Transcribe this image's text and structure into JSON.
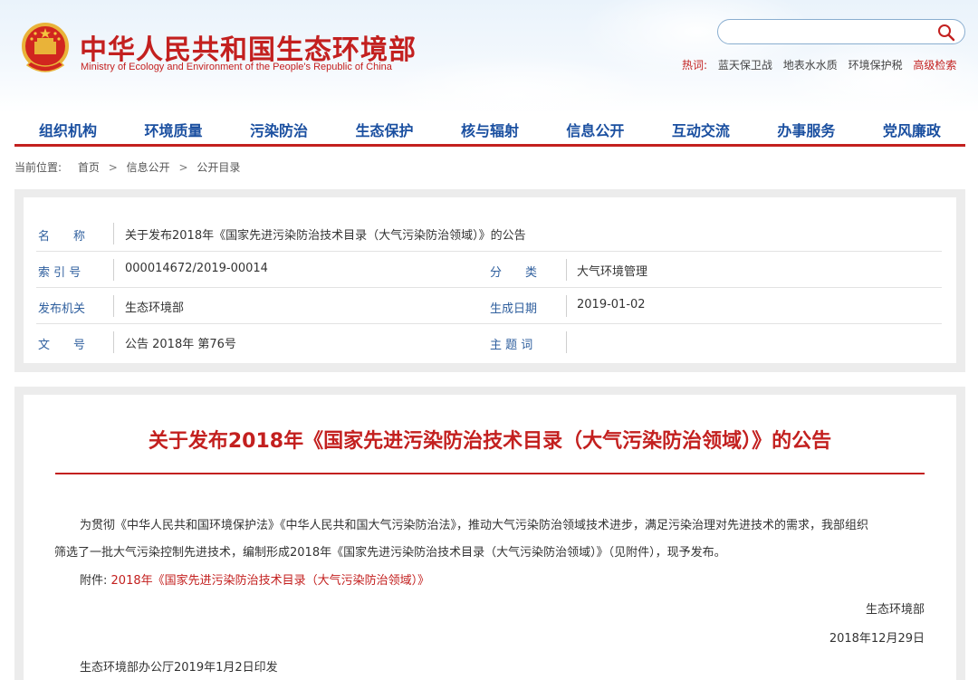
{
  "header": {
    "title_cn": "中华人民共和国生态环境部",
    "title_en": "Ministry of Ecology and Environment of the People's Republic of China",
    "search": {
      "placeholder": ""
    },
    "hotwords_label": "热词:",
    "hotwords": [
      "蓝天保卫战",
      "地表水水质",
      "环境保护税"
    ],
    "advanced_search": "高级检索"
  },
  "nav": {
    "items": [
      "组织机构",
      "环境质量",
      "污染防治",
      "生态保护",
      "核与辐射",
      "信息公开",
      "互动交流",
      "办事服务",
      "党风廉政"
    ]
  },
  "breadcrumb": {
    "label": "当前位置:",
    "items": [
      "首页",
      "信息公开",
      "公开目录"
    ],
    "separator": ">"
  },
  "meta": {
    "name_label": "名　　称",
    "name_value": "关于发布2018年《国家先进污染防治技术目录（大气污染防治领域）》的公告",
    "index_label": "索 引 号",
    "index_value": "000014672/2019-00014",
    "category_label": "分　　类",
    "category_value": "大气环境管理",
    "issuer_label": "发布机关",
    "issuer_value": "生态环境部",
    "date_label": "生成日期",
    "date_value": "2019-01-02",
    "doc_no_label": "文　　号",
    "doc_no_value": "公告 2018年 第76号",
    "keywords_label": "主 题 词",
    "keywords_value": ""
  },
  "article": {
    "title": "关于发布2018年《国家先进污染防治技术目录（大气污染防治领域）》的公告",
    "para1_line1": "为贯彻《中华人民共和国环境保护法》《中华人民共和国大气污染防治法》，推动大气污染防治领域技术进步，满足污染治理对先进技术的需求，我部组织",
    "para1_line2": "筛选了一批大气污染控制先进技术，编制形成2018年《国家先进污染防治技术目录（大气污染防治领域）》（见附件），现予发布。",
    "attachment_label": "附件:",
    "attachment_link": "2018年《国家先进污染防治技术目录（大气污染防治领域）》",
    "signer": "生态环境部",
    "sign_date": "2018年12月29日",
    "footer": "生态环境部办公厅2019年1月2日印发"
  },
  "colors": {
    "brand_red": "#c3201f",
    "nav_blue": "#1a4fa0",
    "label_blue": "#2f5f9e"
  }
}
